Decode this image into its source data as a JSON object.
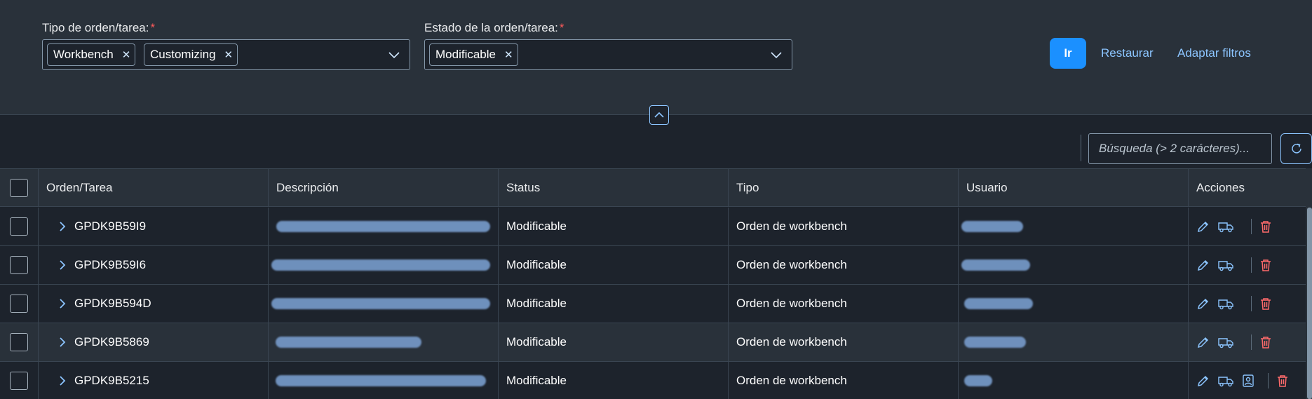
{
  "filters": {
    "type": {
      "label": "Tipo de orden/tarea:",
      "required_mark": "*",
      "tokens": [
        "Workbench",
        "Customizing"
      ]
    },
    "status": {
      "label": "Estado de la orden/tarea:",
      "required_mark": "*",
      "tokens": [
        "Modificable"
      ]
    },
    "go_label": "Ir",
    "reset_label": "Restaurar",
    "adapt_label": "Adaptar filtros",
    "token_remove_glyph": "✕"
  },
  "toolbar": {
    "search_placeholder": "Búsqueda (> 2 carácteres)..."
  },
  "table": {
    "columns": [
      "Orden/Tarea",
      "Descripción",
      "Status",
      "Tipo",
      "Usuario",
      "Acciones"
    ],
    "rows": [
      {
        "order": "GPDK9B59I9",
        "status": "Modificable",
        "type": "Orden de workbench"
      },
      {
        "order": "GPDK9B59I6",
        "status": "Modificable",
        "type": "Orden de workbench"
      },
      {
        "order": "GPDK9B594D",
        "status": "Modificable",
        "type": "Orden de workbench"
      },
      {
        "order": "GPDK9B5869",
        "status": "Modificable",
        "type": "Orden de workbench"
      },
      {
        "order": "GPDK9B5215",
        "status": "Modificable",
        "type": "Orden de workbench"
      }
    ]
  },
  "icons": {
    "remove": "close-icon",
    "dropdown": "chevron-down-icon",
    "collapse": "chevron-up-icon",
    "refresh": "refresh-icon",
    "expand": "chevron-right-icon",
    "edit": "pencil-icon",
    "release": "truck-icon",
    "owner": "user-card-icon",
    "delete": "trash-icon"
  },
  "colors": {
    "accent": "#1b90ff",
    "link": "#8cc5ff",
    "required": "#ff5a5a",
    "delete": "#ff6b6b",
    "redaction": "#7396c4"
  }
}
